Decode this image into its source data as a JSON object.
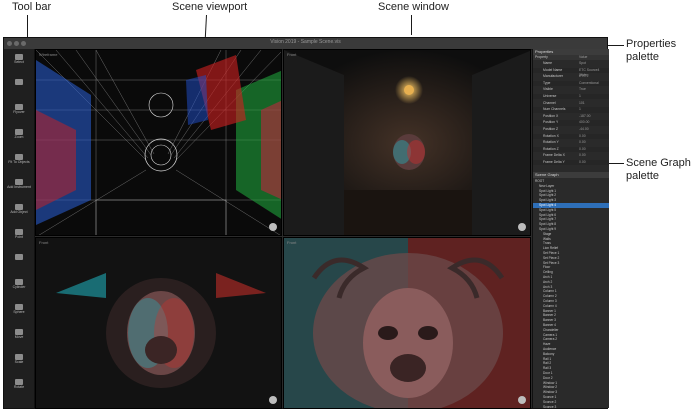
{
  "callouts": {
    "tool_bar": "Tool bar",
    "scene_viewport": "Scene viewport",
    "scene_window": "Scene window",
    "properties_palette": [
      "Properties",
      "palette"
    ],
    "scene_graph_palette": [
      "Scene Graph",
      "palette"
    ]
  },
  "window": {
    "title": "Vision 2019 - Sample Scene.vis"
  },
  "toolbar": {
    "tools": [
      {
        "label": "Select",
        "icon": "arrow-icon"
      },
      {
        "label": "",
        "icon": "orbit-icon"
      },
      {
        "label": "Flyover",
        "icon": "flyover-icon"
      },
      {
        "label": "Zoom",
        "icon": "zoom-icon"
      },
      {
        "label": "Fit To Objects",
        "icon": "fit-icon"
      },
      {
        "label": "Add Instrument",
        "icon": "instrument-icon"
      },
      {
        "label": "Add Object",
        "icon": "add-object-icon"
      },
      {
        "label": "Point",
        "icon": "point-icon"
      },
      {
        "label": "",
        "icon": "line-icon"
      },
      {
        "label": "Cylinder",
        "icon": "cylinder-icon"
      },
      {
        "label": "Sphere",
        "icon": "sphere-icon"
      },
      {
        "label": "Move",
        "icon": "move-icon"
      },
      {
        "label": "Scale",
        "icon": "scale-icon"
      },
      {
        "label": "Rotate",
        "icon": "rotate-icon"
      }
    ]
  },
  "viewports": [
    {
      "label": "Wireframe"
    },
    {
      "label": "Front"
    },
    {
      "label": "Front"
    },
    {
      "label": "Front"
    }
  ],
  "properties": {
    "title": "Properties",
    "columns": [
      "Property",
      "Value"
    ],
    "rows": [
      {
        "k": "Name",
        "v": "Spot"
      },
      {
        "k": "Model Name",
        "v": "ETC Source4 36deg"
      },
      {
        "k": "Manufacturer",
        "v": "ETC"
      },
      {
        "k": "Type",
        "v": "Conventional"
      },
      {
        "k": "Visible",
        "v": "True"
      },
      {
        "k": "Universe",
        "v": "1"
      },
      {
        "k": "Channel",
        "v": "101"
      },
      {
        "k": "Num Channels",
        "v": "1"
      },
      {
        "k": "Position X",
        "v": "-187.00"
      },
      {
        "k": "Position Y",
        "v": "400.00"
      },
      {
        "k": "Position Z",
        "v": "-44.00"
      },
      {
        "k": "Rotation X",
        "v": "0.00"
      },
      {
        "k": "Rotation Y",
        "v": "0.00"
      },
      {
        "k": "Rotation Z",
        "v": "0.00"
      },
      {
        "k": "Frame Delta X",
        "v": "0.00"
      },
      {
        "k": "Frame Delta Y",
        "v": "0.00"
      }
    ]
  },
  "scene_graph": {
    "title": "Scene Graph",
    "items": [
      "ROOT",
      "New Layer",
      "Spot Light 1",
      "Spot Light 2",
      "Spot Light 3",
      "Spot Light 4",
      "Spot Light 5",
      "Spot Light 6",
      "Spot Light 7",
      "Spot Light 8",
      "Spot Light 9",
      "Stage",
      "Walls",
      "Truss",
      "Lion Relief",
      "Set Piece 1",
      "Set Piece 2",
      "Set Piece 3",
      "Floor",
      "Ceiling",
      "Arch 1",
      "Arch 2",
      "Arch 3",
      "Column 1",
      "Column 2",
      "Column 3",
      "Column 4",
      "Banner 1",
      "Banner 2",
      "Banner 3",
      "Banner 4",
      "Chandelier",
      "Camera 1",
      "Camera 2",
      "Haze",
      "Audience",
      "Balcony",
      "Rail 1",
      "Rail 2",
      "Rail 3",
      "Door 1",
      "Door 2",
      "Window 1",
      "Window 2",
      "Window 3",
      "Sconce 1",
      "Sconce 2",
      "Sconce 3",
      "Sconce 4"
    ],
    "selected_index": 5
  },
  "colors": {
    "app_bg": "#2b2b2b",
    "selection": "#2e6fb8",
    "cyan_light": "#1fb6c2",
    "red_light": "#d0302a"
  }
}
